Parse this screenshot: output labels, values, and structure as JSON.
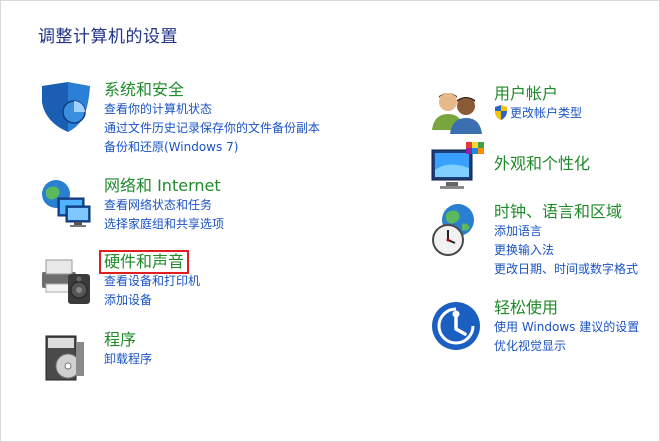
{
  "page_title": "调整计算机的设置",
  "categories": {
    "system_security": {
      "title": "系统和安全",
      "links": [
        "查看你的计算机状态",
        "通过文件历史记录保存你的文件备份副本",
        "备份和还原(Windows 7)"
      ]
    },
    "network": {
      "title": "网络和 Internet",
      "links": [
        "查看网络状态和任务",
        "选择家庭组和共享选项"
      ]
    },
    "hardware_sound": {
      "title": "硬件和声音",
      "links": [
        "查看设备和打印机",
        "添加设备"
      ]
    },
    "programs": {
      "title": "程序",
      "links": [
        "卸载程序"
      ]
    },
    "user_accounts": {
      "title": "用户帐户",
      "links": [
        "更改帐户类型"
      ]
    },
    "appearance": {
      "title": "外观和个性化",
      "links": []
    },
    "clock_region": {
      "title": "时钟、语言和区域",
      "links": [
        "添加语言",
        "更换输入法",
        "更改日期、时间或数字格式"
      ]
    },
    "ease_of_access": {
      "title": "轻松使用",
      "links": [
        "使用 Windows 建议的设置",
        "优化视觉显示"
      ]
    }
  },
  "colors": {
    "title_blue": "#1e3287",
    "category_green": "#1f8a2a",
    "link_blue": "#1a53c4",
    "highlight_red": "#e02020"
  },
  "icons": {
    "system_security": "shield-icon",
    "network": "network-computers-icon",
    "hardware_sound": "printer-speaker-icon",
    "programs": "programs-box-icon",
    "user_accounts": "users-icon",
    "appearance": "monitor-palette-icon",
    "clock_region": "clock-globe-icon",
    "ease_of_access": "ease-of-access-icon",
    "uac_shield": "uac-shield-icon"
  }
}
